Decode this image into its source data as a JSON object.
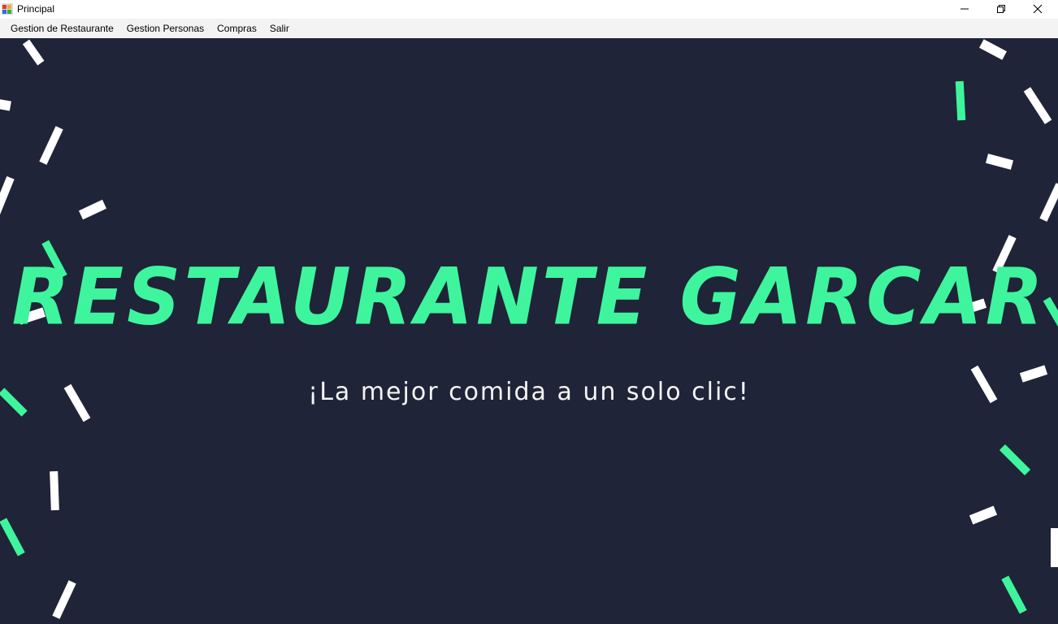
{
  "window": {
    "title": "Principal"
  },
  "menu": {
    "items": [
      {
        "label": "Gestion de Restaurante"
      },
      {
        "label": "Gestion Personas"
      },
      {
        "label": "Compras"
      },
      {
        "label": "Salir"
      }
    ]
  },
  "main": {
    "headline": "RESTAURANTE GARCAR",
    "tagline": "¡La mejor comida a un solo clic!"
  },
  "colors": {
    "background": "#1f2438",
    "accent": "#3ef59d",
    "confetti_light": "#ffffff"
  }
}
